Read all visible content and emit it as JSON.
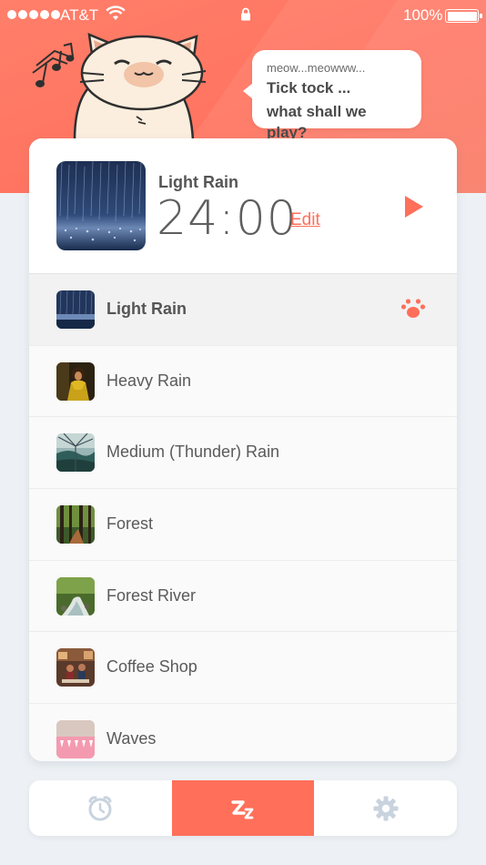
{
  "status_bar": {
    "carrier": "AT&T",
    "battery_percent": "100%",
    "battery_level": 1.0
  },
  "bubble": {
    "line1": "meow...meowww...",
    "line2": "Tick tock ...",
    "line3": "what shall we play?"
  },
  "now_playing": {
    "title": "Light Rain",
    "timer": "24:00",
    "edit_label": "Edit"
  },
  "sounds": [
    {
      "label": "Light Rain",
      "selected": true,
      "thumb": "light-rain"
    },
    {
      "label": "Heavy Rain",
      "selected": false,
      "thumb": "heavy-rain"
    },
    {
      "label": "Medium (Thunder) Rain",
      "selected": false,
      "thumb": "thunder-rain"
    },
    {
      "label": "Forest",
      "selected": false,
      "thumb": "forest"
    },
    {
      "label": "Forest River",
      "selected": false,
      "thumb": "forest-river"
    },
    {
      "label": "Coffee Shop",
      "selected": false,
      "thumb": "coffee-shop"
    },
    {
      "label": "Waves",
      "selected": false,
      "thumb": "waves"
    }
  ],
  "tabs": [
    {
      "name": "alarm",
      "icon": "alarm-clock-icon",
      "active": false
    },
    {
      "name": "sleep",
      "icon": "sleep-zz-icon",
      "active": true
    },
    {
      "name": "settings",
      "icon": "gear-icon",
      "active": false
    }
  ],
  "colors": {
    "accent": "#ff6f5a",
    "background": "#edf1f5",
    "inactive_icon": "#c8d3de"
  }
}
